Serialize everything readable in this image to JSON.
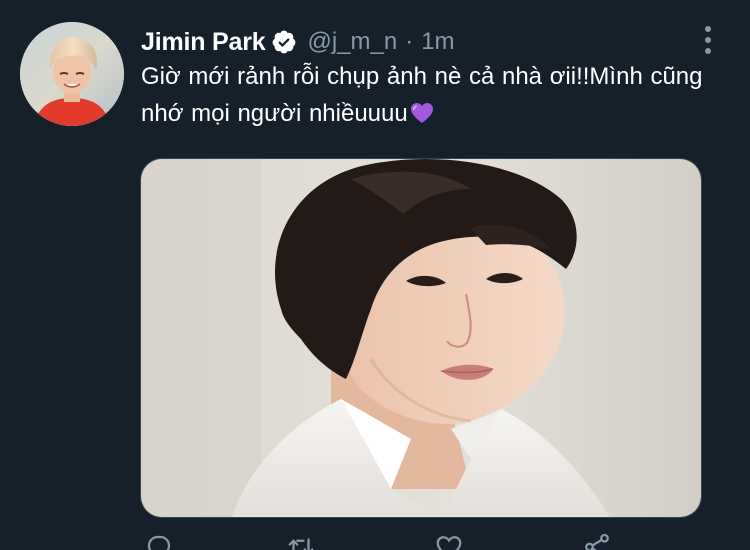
{
  "user": {
    "display_name": "Jimin Park",
    "handle": "@j_m_n",
    "separator": "·",
    "time": "1m",
    "verified": true
  },
  "tweet": {
    "text": "Giờ mới rảnh rỗi chụp ảnh nè cả nhà ơii!!Mình cũng nhớ mọi người nhiềuuuu",
    "emoji": "purple-heart"
  },
  "colors": {
    "background": "#15202b",
    "text_primary": "#ffffff",
    "text_secondary": "#8899a6",
    "border": "#38444d",
    "emoji_heart": "#a259e0"
  },
  "icons": {
    "more": "more-vertical-icon",
    "verified": "verified-badge-icon",
    "reply": "reply-icon",
    "retweet": "retweet-icon",
    "like": "like-icon",
    "share": "share-icon"
  }
}
